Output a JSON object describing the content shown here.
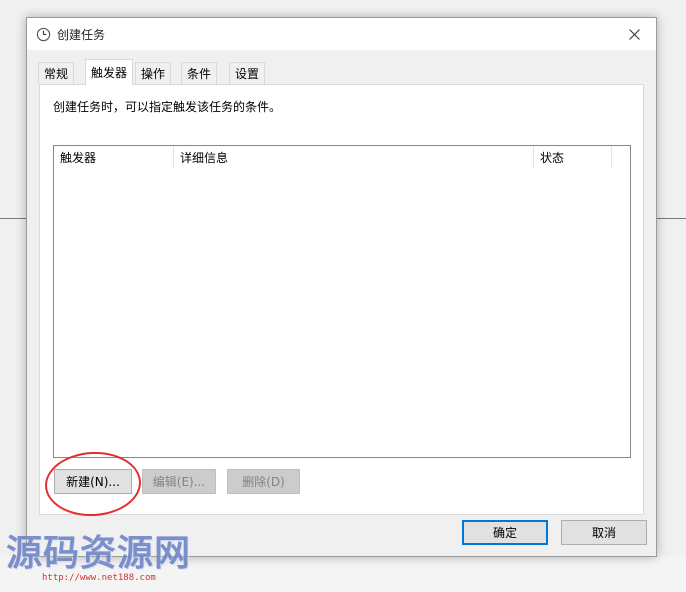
{
  "window": {
    "title": "创建任务",
    "close_label": "关闭"
  },
  "tabs": [
    {
      "label": "常规",
      "active": false
    },
    {
      "label": "触发器",
      "active": true
    },
    {
      "label": "操作",
      "active": false
    },
    {
      "label": "条件",
      "active": false
    },
    {
      "label": "设置",
      "active": false
    }
  ],
  "triggers_panel": {
    "description": "创建任务时，可以指定触发该任务的条件。",
    "columns": [
      "触发器",
      "详细信息",
      "状态"
    ],
    "rows": [],
    "buttons": {
      "new": "新建(N)...",
      "edit": "编辑(E)...",
      "delete": "删除(D)"
    }
  },
  "footer": {
    "ok": "确定",
    "cancel": "取消"
  },
  "watermark": {
    "text": "源码资源网",
    "url": "http://www.net188.com"
  },
  "colors": {
    "accent": "#0078d7",
    "highlight_circle": "#e3302f",
    "watermark": "#6f85c6"
  }
}
